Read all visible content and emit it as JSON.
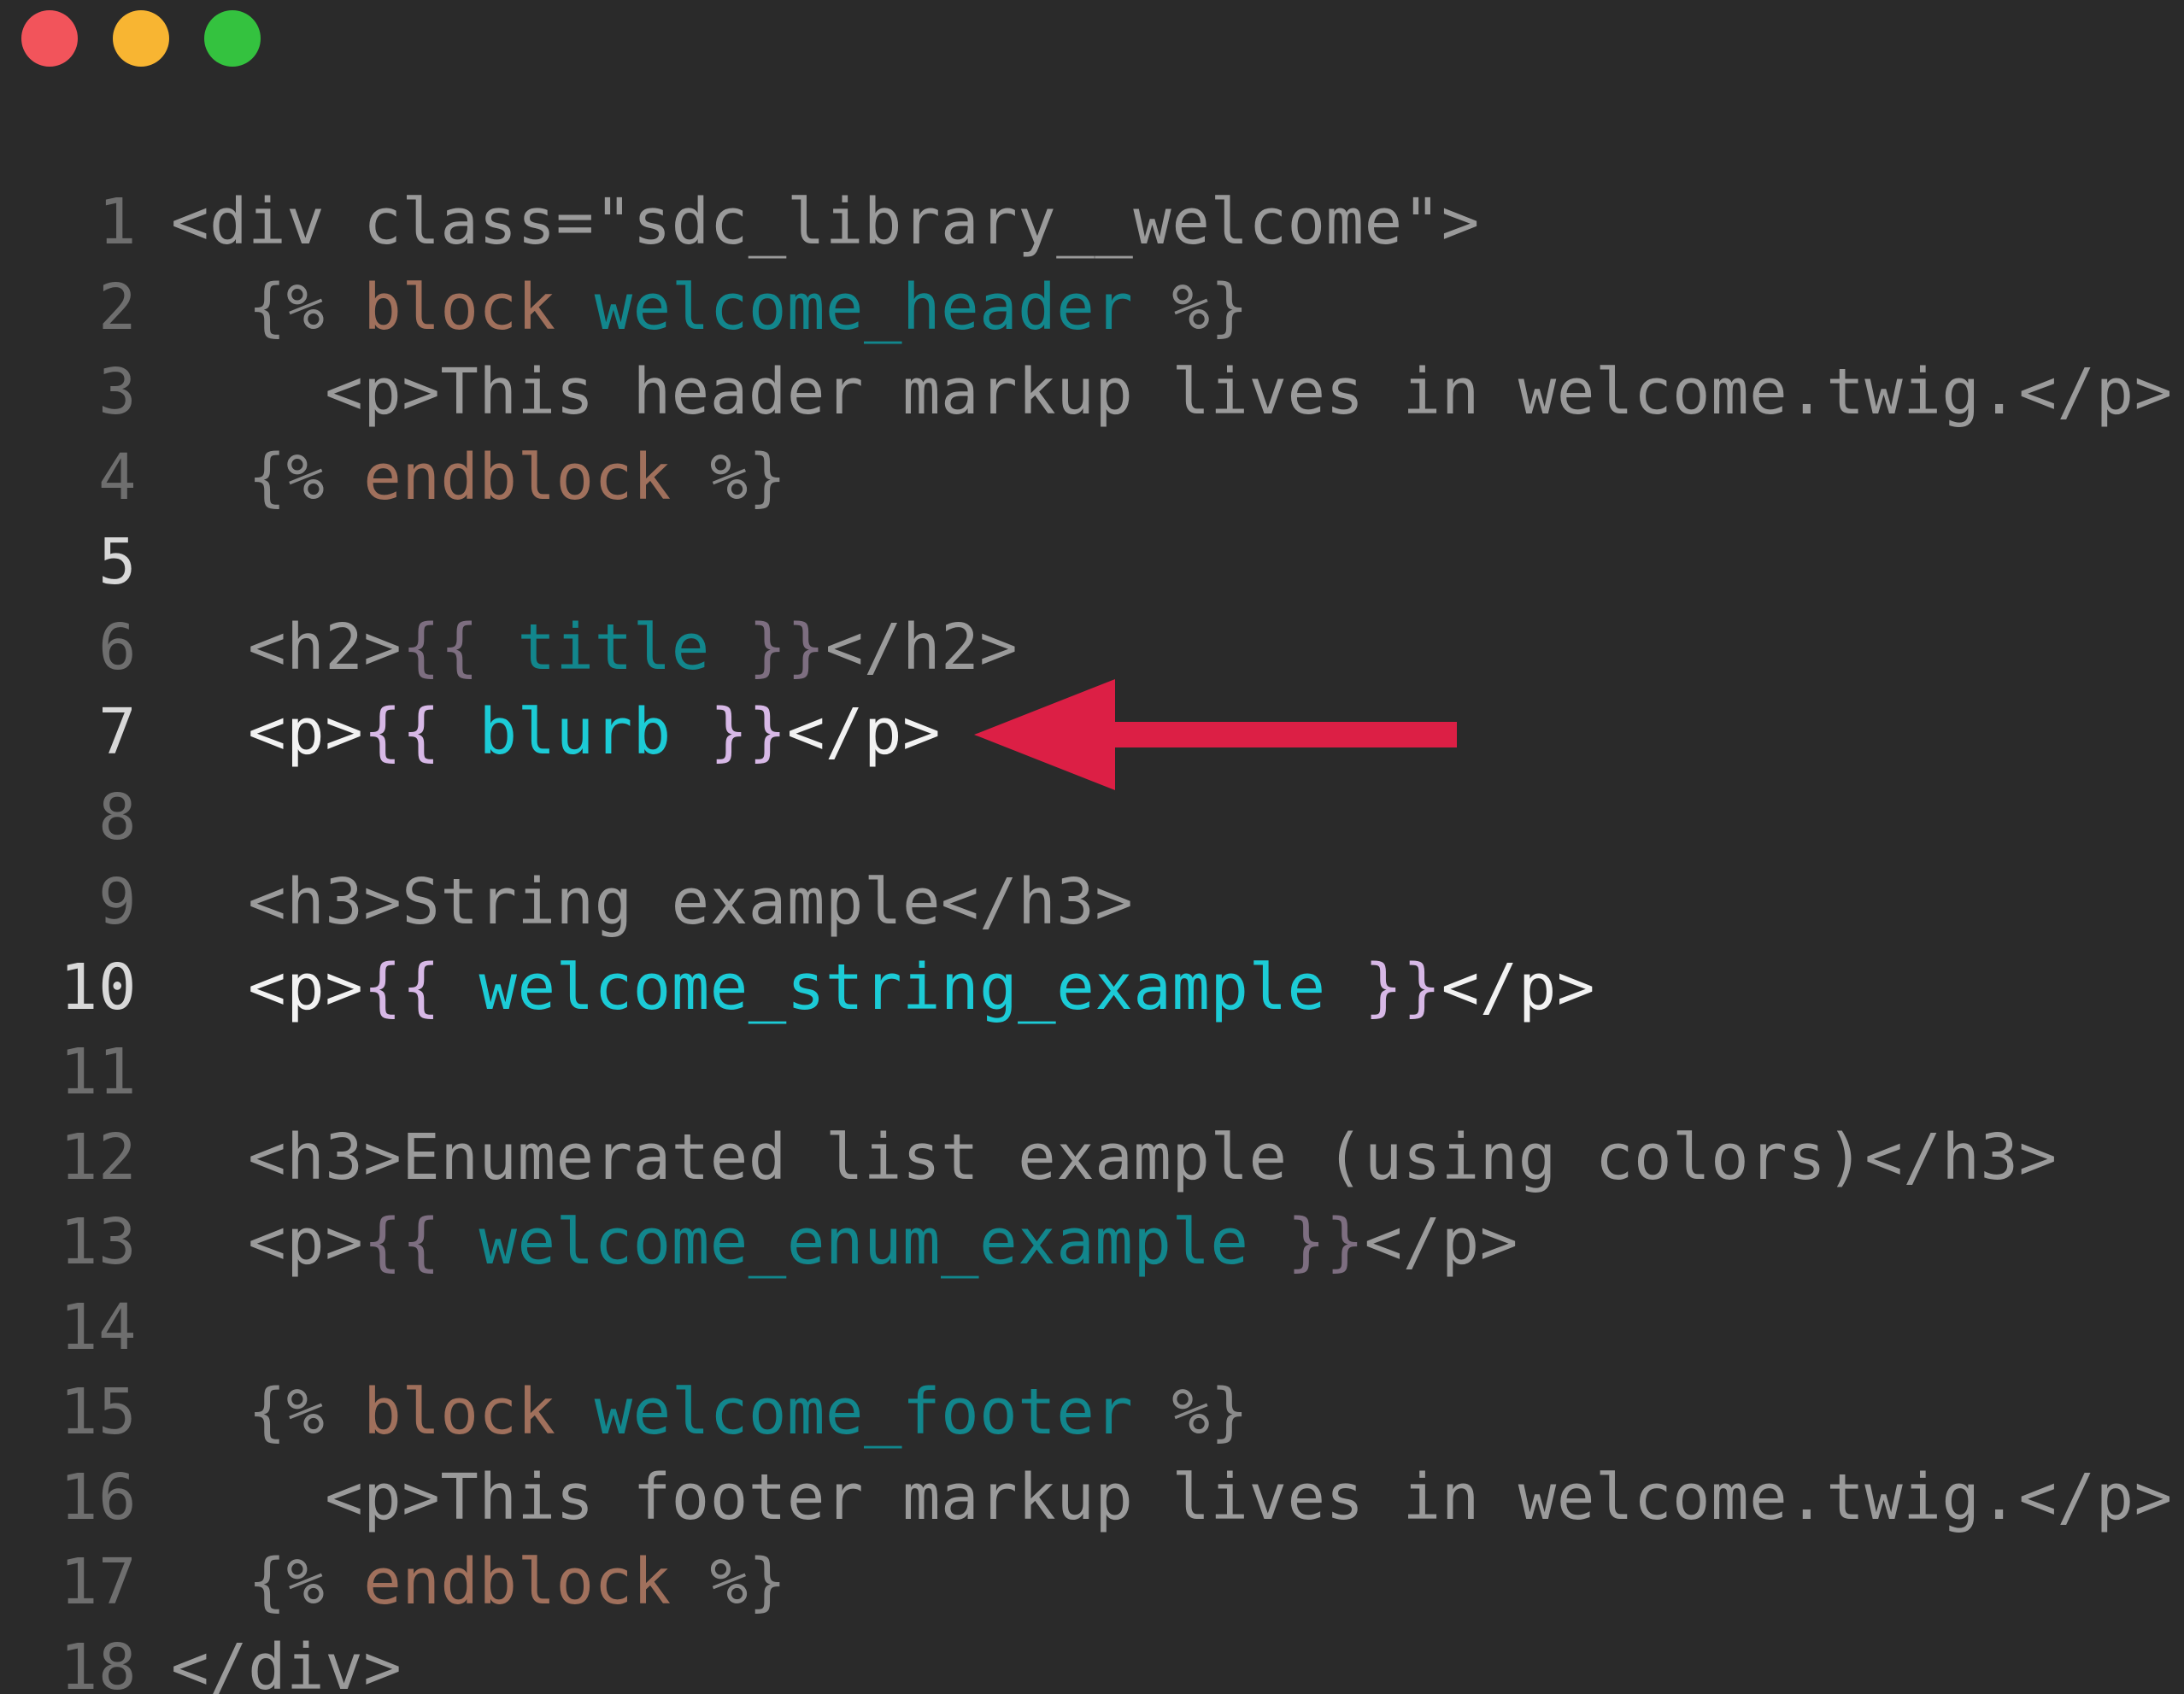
{
  "window": {
    "controls": [
      "close",
      "minimize",
      "maximize"
    ]
  },
  "colors": {
    "background": "#2a2a2a",
    "close": "#f2545b",
    "minimize": "#f8b532",
    "maximize": "#34c23f",
    "arrow": "#dc1f45"
  },
  "lines": [
    {
      "num": "1",
      "tokens": [
        {
          "t": "<div class=\"sdc_library__welcome\">",
          "c": "tag-dim"
        }
      ]
    },
    {
      "num": "2",
      "tokens": [
        {
          "t": "  ",
          "c": "tag-dim"
        },
        {
          "t": "{%",
          "c": "pct"
        },
        {
          "t": " ",
          "c": "tag-dim"
        },
        {
          "t": "block",
          "c": "kw"
        },
        {
          "t": " ",
          "c": "tag-dim"
        },
        {
          "t": "welcome_header",
          "c": "var-dim"
        },
        {
          "t": " %}",
          "c": "pct"
        }
      ]
    },
    {
      "num": "3",
      "tokens": [
        {
          "t": "    <p>This header markup lives in welcome.twig.</p>",
          "c": "tag-dim"
        }
      ]
    },
    {
      "num": "4",
      "tokens": [
        {
          "t": "  ",
          "c": "tag-dim"
        },
        {
          "t": "{%",
          "c": "pct"
        },
        {
          "t": " ",
          "c": "tag-dim"
        },
        {
          "t": "endblock",
          "c": "kw"
        },
        {
          "t": " %}",
          "c": "pct"
        }
      ]
    },
    {
      "num": "5",
      "tokens": []
    },
    {
      "num": "6",
      "tokens": [
        {
          "t": "  <h2>",
          "c": "tag-dim"
        },
        {
          "t": "{{",
          "c": "brace-dim"
        },
        {
          "t": " ",
          "c": "tag-dim"
        },
        {
          "t": "title",
          "c": "var-dim"
        },
        {
          "t": " ",
          "c": "tag-dim"
        },
        {
          "t": "}}",
          "c": "brace-dim"
        },
        {
          "t": "</h2>",
          "c": "tag-dim"
        }
      ]
    },
    {
      "num": "7",
      "tokens": [
        {
          "t": "  <p>",
          "c": "tag-bright"
        },
        {
          "t": "{{",
          "c": "brace-bright"
        },
        {
          "t": " ",
          "c": "tag-bright"
        },
        {
          "t": "blurb",
          "c": "var-bright"
        },
        {
          "t": " ",
          "c": "tag-bright"
        },
        {
          "t": "}}",
          "c": "brace-bright"
        },
        {
          "t": "</p>",
          "c": "tag-bright"
        }
      ]
    },
    {
      "num": "8",
      "tokens": []
    },
    {
      "num": "9",
      "tokens": [
        {
          "t": "  <h3>String example</h3>",
          "c": "tag-dim"
        }
      ]
    },
    {
      "num": "10",
      "tokens": [
        {
          "t": "  <p>",
          "c": "tag-bright"
        },
        {
          "t": "{{",
          "c": "brace-bright"
        },
        {
          "t": " ",
          "c": "tag-bright"
        },
        {
          "t": "welcome_string_example",
          "c": "var-bright"
        },
        {
          "t": " ",
          "c": "tag-bright"
        },
        {
          "t": "}}",
          "c": "brace-bright"
        },
        {
          "t": "</p>",
          "c": "tag-bright"
        }
      ]
    },
    {
      "num": "11",
      "tokens": []
    },
    {
      "num": "12",
      "tokens": [
        {
          "t": "  <h3>Enumerated list example (using colors)</h3>",
          "c": "tag-dim"
        }
      ]
    },
    {
      "num": "13",
      "tokens": [
        {
          "t": "  <p>",
          "c": "tag-dim"
        },
        {
          "t": "{{",
          "c": "brace-dim"
        },
        {
          "t": " ",
          "c": "tag-dim"
        },
        {
          "t": "welcome_enum_example",
          "c": "var-dim"
        },
        {
          "t": " ",
          "c": "tag-dim"
        },
        {
          "t": "}}",
          "c": "brace-dim"
        },
        {
          "t": "</p>",
          "c": "tag-dim"
        }
      ]
    },
    {
      "num": "14",
      "tokens": []
    },
    {
      "num": "15",
      "tokens": [
        {
          "t": "  ",
          "c": "tag-dim"
        },
        {
          "t": "{%",
          "c": "pct"
        },
        {
          "t": " ",
          "c": "tag-dim"
        },
        {
          "t": "block",
          "c": "kw"
        },
        {
          "t": " ",
          "c": "tag-dim"
        },
        {
          "t": "welcome_footer",
          "c": "var-dim"
        },
        {
          "t": " %}",
          "c": "pct"
        }
      ]
    },
    {
      "num": "16",
      "tokens": [
        {
          "t": "    <p>This footer markup lives in welcome.twig.</p>",
          "c": "tag-dim"
        }
      ]
    },
    {
      "num": "17",
      "tokens": [
        {
          "t": "  ",
          "c": "tag-dim"
        },
        {
          "t": "{%",
          "c": "pct"
        },
        {
          "t": " ",
          "c": "tag-dim"
        },
        {
          "t": "endblock",
          "c": "kw"
        },
        {
          "t": " %}",
          "c": "pct"
        }
      ]
    },
    {
      "num": "18",
      "tokens": [
        {
          "t": "</div>",
          "c": "tag-dim"
        }
      ]
    }
  ],
  "highlighted_lines": [
    "5",
    "7",
    "10"
  ],
  "annotation": {
    "type": "arrow",
    "points_to_line": "7",
    "direction": "left"
  }
}
